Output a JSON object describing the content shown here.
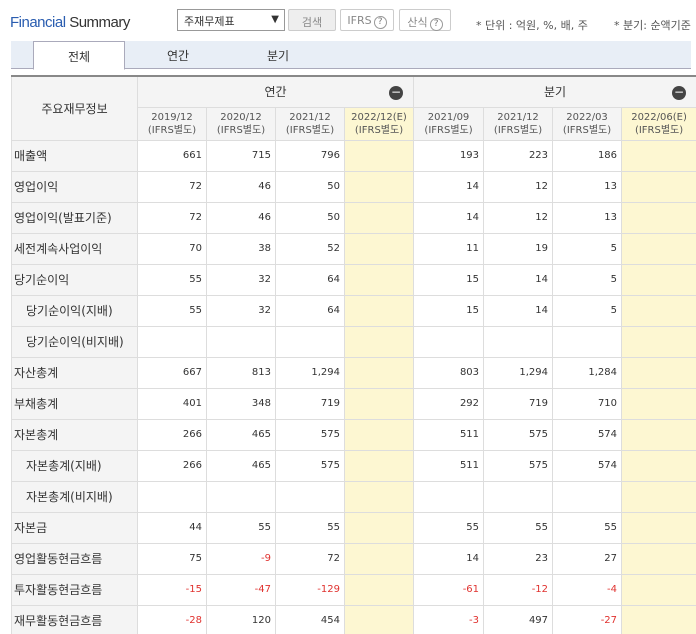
{
  "header": {
    "title_part1": "Financial",
    "title_part2": " Summary",
    "select_value": "주재무제표",
    "search_label": "검색",
    "ifrs_label": "IFRS",
    "formula_label": "산식",
    "unit_note": "* 단위 : 억원, %, 배, 주",
    "quarter_note": "* 분기: 순액기준"
  },
  "tabs": [
    "전체",
    "연간",
    "분기"
  ],
  "table": {
    "corner_label": "주요재무정보",
    "annual_label": "연간",
    "quarter_label": "분기",
    "periods": [
      {
        "date": "2019/12",
        "basis": "(IFRS별도)"
      },
      {
        "date": "2020/12",
        "basis": "(IFRS별도)"
      },
      {
        "date": "2021/12",
        "basis": "(IFRS별도)"
      },
      {
        "date": "2022/12(E)",
        "basis": "(IFRS별도)"
      },
      {
        "date": "2021/09",
        "basis": "(IFRS별도)"
      },
      {
        "date": "2021/12",
        "basis": "(IFRS별도)"
      },
      {
        "date": "2022/03",
        "basis": "(IFRS별도)"
      },
      {
        "date": "2022/06(E)",
        "basis": "(IFRS별도)"
      }
    ],
    "rows": [
      {
        "label": "매출액",
        "sub": false,
        "values": [
          "661",
          "715",
          "796",
          "",
          "193",
          "223",
          "186",
          ""
        ]
      },
      {
        "label": "영업이익",
        "sub": false,
        "values": [
          "72",
          "46",
          "50",
          "",
          "14",
          "12",
          "13",
          ""
        ]
      },
      {
        "label": "영업이익(발표기준)",
        "sub": false,
        "values": [
          "72",
          "46",
          "50",
          "",
          "14",
          "12",
          "13",
          ""
        ]
      },
      {
        "label": "세전계속사업이익",
        "sub": false,
        "values": [
          "70",
          "38",
          "52",
          "",
          "11",
          "19",
          "5",
          ""
        ]
      },
      {
        "label": "당기순이익",
        "sub": false,
        "values": [
          "55",
          "32",
          "64",
          "",
          "15",
          "14",
          "5",
          ""
        ]
      },
      {
        "label": "당기순이익(지배)",
        "sub": true,
        "values": [
          "55",
          "32",
          "64",
          "",
          "15",
          "14",
          "5",
          ""
        ]
      },
      {
        "label": "당기순이익(비지배)",
        "sub": true,
        "values": [
          "",
          "",
          "",
          "",
          "",
          "",
          "",
          ""
        ]
      },
      {
        "label": "자산총계",
        "sub": false,
        "values": [
          "667",
          "813",
          "1,294",
          "",
          "803",
          "1,294",
          "1,284",
          ""
        ]
      },
      {
        "label": "부채총계",
        "sub": false,
        "values": [
          "401",
          "348",
          "719",
          "",
          "292",
          "719",
          "710",
          ""
        ]
      },
      {
        "label": "자본총계",
        "sub": false,
        "values": [
          "266",
          "465",
          "575",
          "",
          "511",
          "575",
          "574",
          ""
        ]
      },
      {
        "label": "자본총계(지배)",
        "sub": true,
        "values": [
          "266",
          "465",
          "575",
          "",
          "511",
          "575",
          "574",
          ""
        ]
      },
      {
        "label": "자본총계(비지배)",
        "sub": true,
        "values": [
          "",
          "",
          "",
          "",
          "",
          "",
          "",
          ""
        ]
      },
      {
        "label": "자본금",
        "sub": false,
        "values": [
          "44",
          "55",
          "55",
          "",
          "55",
          "55",
          "55",
          ""
        ]
      },
      {
        "label": "영업활동현금흐름",
        "sub": false,
        "values": [
          "75",
          "-9",
          "72",
          "",
          "14",
          "23",
          "27",
          ""
        ]
      },
      {
        "label": "투자활동현금흐름",
        "sub": false,
        "values": [
          "-15",
          "-47",
          "-129",
          "",
          "-61",
          "-12",
          "-4",
          ""
        ]
      },
      {
        "label": "재무활동현금흐름",
        "sub": false,
        "values": [
          "-28",
          "120",
          "454",
          "",
          "-3",
          "497",
          "-27",
          ""
        ]
      }
    ]
  }
}
